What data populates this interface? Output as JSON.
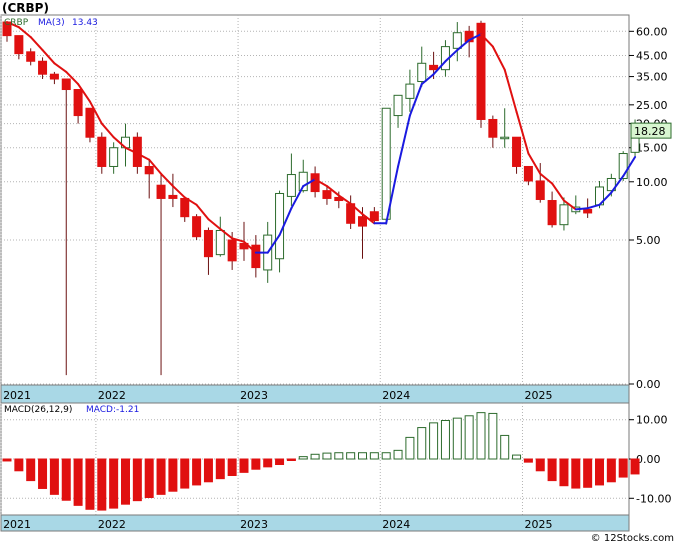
{
  "title": "(CRBP)",
  "credit": "© 12Stocks.com",
  "colors": {
    "up": "#2d6b2d",
    "down": "#e01010",
    "ma_down": "#e01010",
    "ma_up": "#1a1ae0",
    "axis_band": "#a9d8e6",
    "grid": "#b4b4b4",
    "price_tag": "#d8f5d0"
  },
  "price_panel": {
    "legend_symbol": "CRBP",
    "legend_ma": "MA(3)",
    "legend_ma_value": "13.43",
    "last_price": "18.28",
    "y_ticks": [
      "60.00",
      "45.00",
      "35.00",
      "25.00",
      "20.00",
      "15.00",
      "10.00",
      "5.00",
      "0.00"
    ],
    "y_tick_values": [
      60,
      45,
      35,
      25,
      20,
      15,
      10,
      5,
      0.9
    ]
  },
  "macd_panel": {
    "legend_macd": "MACD(26,12,9)",
    "legend_value": "MACD:-1.21",
    "y_ticks": [
      "10.00",
      "0.00",
      "-10.00"
    ],
    "y_tick_values": [
      10,
      0,
      -10
    ]
  },
  "x_labels": [
    "2021",
    "2022",
    "2023",
    "2024",
    "2025"
  ],
  "chart_data": [
    {
      "type": "candlestick",
      "title": "(CRBP)",
      "y_scale": "log",
      "ylim": [
        0.9,
        72
      ],
      "periods": 53,
      "x_tick_labels": [
        {
          "label": "2021",
          "index": 0
        },
        {
          "label": "2022",
          "index": 8
        },
        {
          "label": "2023",
          "index": 20
        },
        {
          "label": "2024",
          "index": 32
        },
        {
          "label": "2025",
          "index": 44
        }
      ],
      "ohlc": [
        [
          67,
          67,
          53,
          57
        ],
        [
          57,
          57,
          43,
          46
        ],
        [
          47,
          49,
          40,
          42
        ],
        [
          42,
          44,
          34,
          36
        ],
        [
          36,
          37,
          32,
          34
        ],
        [
          34,
          34,
          1.0,
          30
        ],
        [
          30,
          30,
          20,
          22
        ],
        [
          24,
          24,
          16,
          17
        ],
        [
          17,
          18,
          11,
          12
        ],
        [
          12,
          16,
          11,
          15
        ],
        [
          15,
          20,
          12,
          17
        ],
        [
          17,
          18,
          11,
          12
        ],
        [
          12,
          13,
          8.2,
          11
        ],
        [
          9.6,
          11,
          1.0,
          8.2
        ],
        [
          8.5,
          11,
          7.4,
          8.2
        ],
        [
          8.2,
          8.4,
          6.2,
          6.6
        ],
        [
          6.6,
          6.8,
          5.0,
          5.2
        ],
        [
          5.6,
          5.8,
          3.3,
          4.1
        ],
        [
          4.2,
          6.6,
          4.1,
          5.6
        ],
        [
          5.0,
          5.5,
          3.5,
          3.9
        ],
        [
          4.8,
          6.2,
          3.9,
          4.5
        ],
        [
          4.7,
          5.3,
          3.2,
          3.6
        ],
        [
          3.5,
          6.2,
          3.0,
          5.3
        ],
        [
          4.0,
          9.0,
          3.4,
          8.7
        ],
        [
          8.4,
          14,
          7.5,
          10.9
        ],
        [
          9.0,
          13,
          8.8,
          11.2
        ],
        [
          11.0,
          12,
          8.3,
          8.9
        ],
        [
          9.0,
          9.5,
          7.6,
          8.2
        ],
        [
          8.3,
          8.9,
          7.3,
          8.0
        ],
        [
          7.7,
          8.5,
          5.7,
          6.1
        ],
        [
          6.6,
          7.4,
          4.0,
          5.9
        ],
        [
          7.0,
          7.4,
          6.1,
          6.3
        ],
        [
          6.4,
          14,
          6.0,
          24
        ],
        [
          22,
          24,
          19,
          28
        ],
        [
          27,
          38,
          23,
          32
        ],
        [
          33,
          50,
          31,
          41
        ],
        [
          40,
          47,
          34,
          38
        ],
        [
          38,
          54,
          35,
          50
        ],
        [
          49,
          67,
          42,
          59
        ],
        [
          60,
          64,
          44,
          53
        ],
        [
          66,
          68,
          19,
          21
        ],
        [
          21,
          22,
          15,
          17
        ],
        [
          17,
          24,
          15,
          17
        ],
        [
          17,
          17,
          11,
          12
        ],
        [
          12,
          12,
          9.6,
          10.1
        ],
        [
          10.1,
          12.5,
          7.8,
          8.1
        ],
        [
          8.0,
          8.9,
          5.8,
          6.0
        ],
        [
          6.0,
          8.3,
          5.6,
          7.6
        ],
        [
          7.0,
          8.5,
          6.8,
          7.4
        ],
        [
          7.2,
          8.2,
          6.5,
          6.9
        ],
        [
          7.6,
          10.1,
          7.3,
          9.4
        ],
        [
          9.0,
          11,
          8.4,
          10.4
        ],
        [
          10.4,
          14.4,
          10.1,
          14.0
        ],
        [
          14.2,
          21,
          13.5,
          18.28
        ]
      ],
      "ma3": [
        67,
        63,
        56,
        48,
        41,
        37,
        32,
        26,
        20,
        17,
        15,
        14,
        13,
        11,
        9.5,
        8.3,
        7.6,
        6.4,
        5.7,
        5.1,
        4.9,
        4.3,
        4.3,
        5.3,
        7.3,
        9.5,
        10.3,
        9.5,
        8.5,
        7.7,
        6.8,
        6.1,
        6.1,
        12,
        22,
        32,
        36,
        42,
        48,
        54,
        58,
        50,
        38,
        23,
        14,
        11,
        9.8,
        8.0,
        7.2,
        7.3,
        7.6,
        8.8,
        10.7,
        13.43
      ],
      "note": "OHLC rows are [open, high, low, close]"
    },
    {
      "type": "bar",
      "title": "MACD(26,12,9)",
      "ylim": [
        -14,
        14
      ],
      "values": [
        -0.5,
        -3,
        -5.5,
        -7.5,
        -9,
        -10.5,
        -11.8,
        -12.8,
        -13,
        -12.5,
        -11.5,
        -10.6,
        -9.8,
        -9,
        -8.2,
        -7.4,
        -6.6,
        -5.8,
        -5,
        -4.2,
        -3.4,
        -2.6,
        -2,
        -1.4,
        -0.3,
        0.6,
        1.2,
        1.5,
        1.6,
        1.6,
        1.6,
        1.6,
        1.6,
        2.2,
        5.5,
        8,
        9.2,
        9.8,
        10.4,
        11,
        11.8,
        11.6,
        6,
        1,
        -0.8,
        -3,
        -5.5,
        -6.8,
        -7.4,
        -7.2,
        -6.6,
        -5.8,
        -4.6,
        -3.8,
        -2.6,
        -1.21
      ]
    }
  ]
}
